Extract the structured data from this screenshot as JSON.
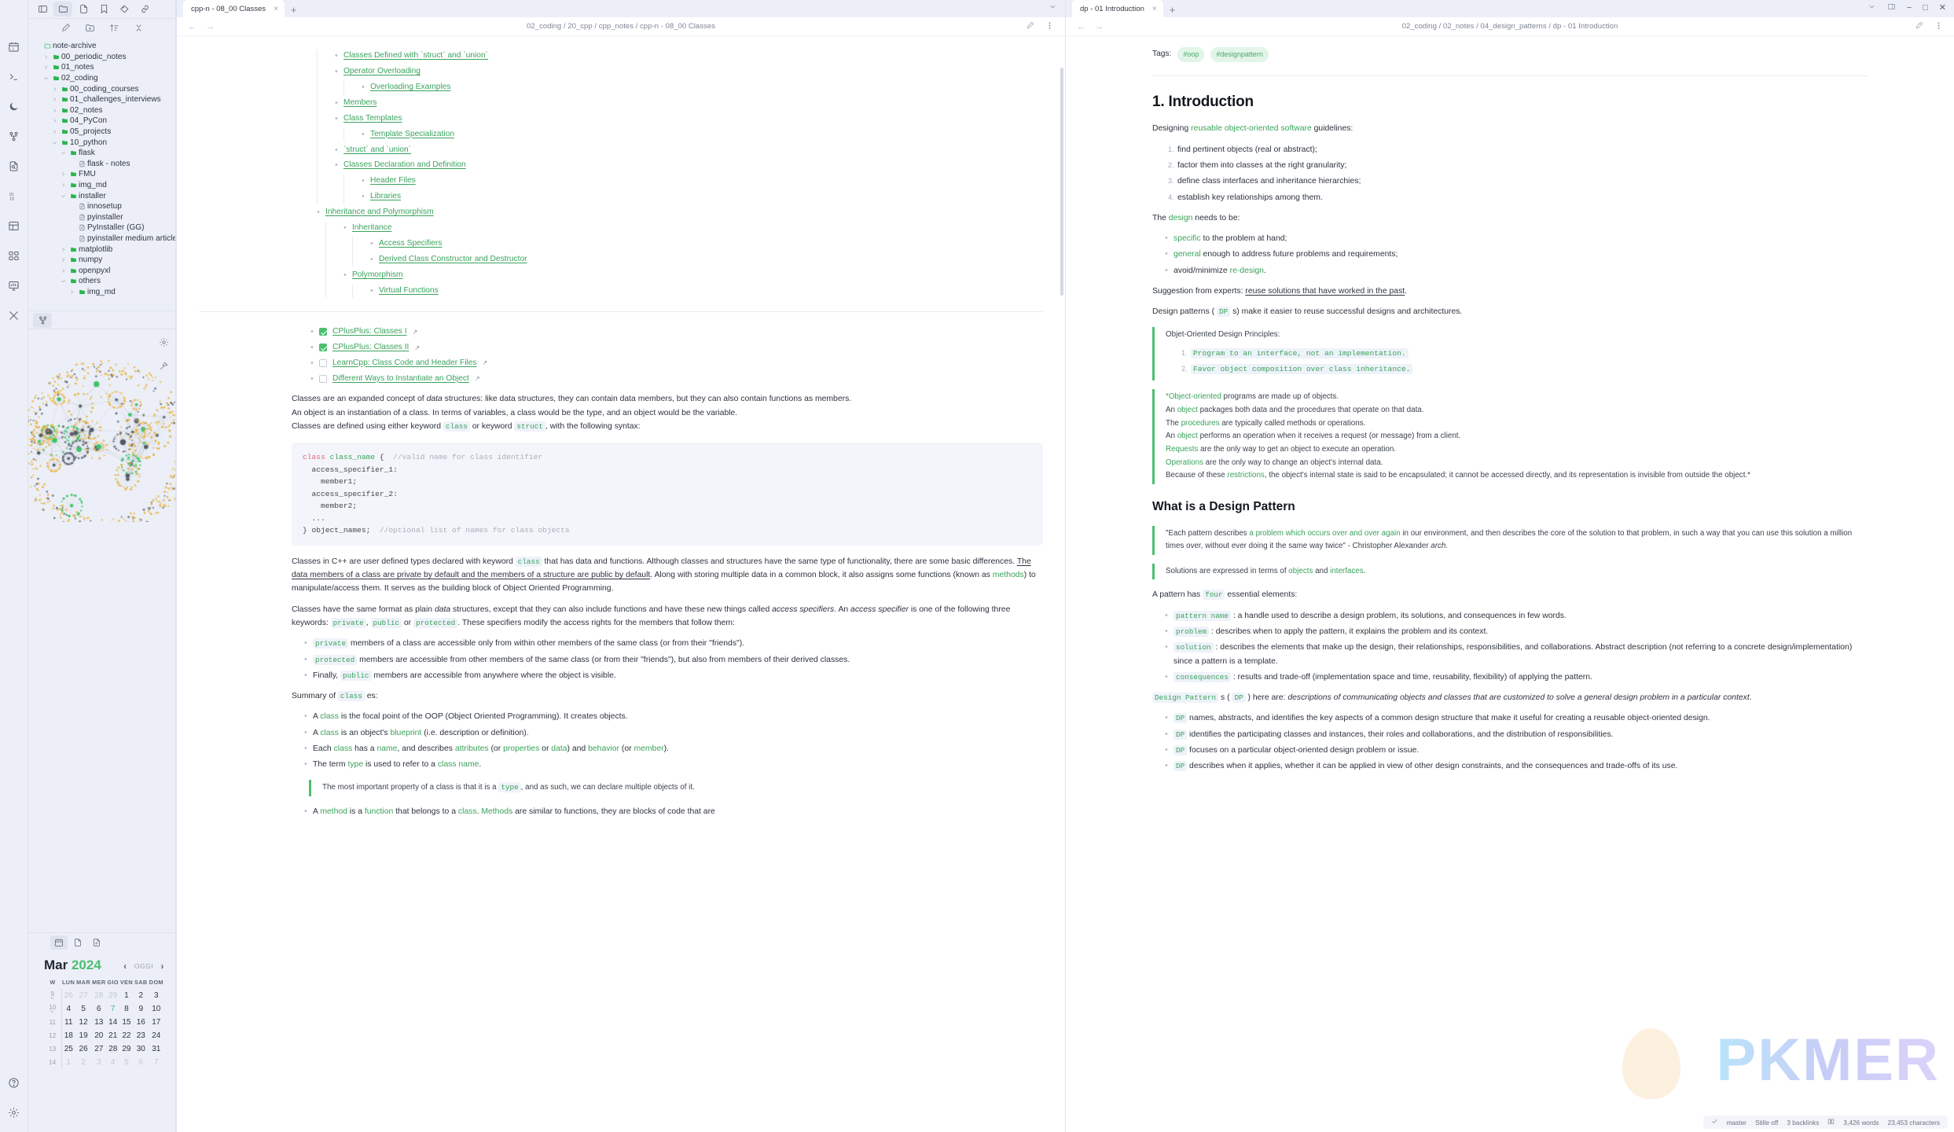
{
  "ribbon": {
    "top_icons": [
      "panel-left-icon",
      "folder-icon",
      "file-icon",
      "bookmark-icon",
      "tags-icon",
      "link-icon"
    ],
    "side_icons": [
      "calendar-icon",
      "terminal-icon",
      "moon-icon",
      "graph-icon",
      "file-search-icon",
      "binary-icon",
      "layout-icon",
      "grid-icon",
      "dashboard-icon",
      "tools-icon"
    ],
    "bottom_icons": [
      "help-icon",
      "settings-icon"
    ]
  },
  "sidebar": {
    "tabs": [
      "calendar-tab-icon",
      "terminal-tab-icon"
    ],
    "toolbar_icons": [
      "new-note-icon",
      "new-folder-icon",
      "sort-icon",
      "collapse-all-icon"
    ],
    "tree": [
      {
        "label": "note-archive",
        "depth": 0,
        "type": "vault",
        "arrow": "",
        "open": true
      },
      {
        "label": "00_periodic_notes",
        "depth": 1,
        "type": "folder",
        "arrow": "right"
      },
      {
        "label": "01_notes",
        "depth": 1,
        "type": "folder",
        "arrow": "right"
      },
      {
        "label": "02_coding",
        "depth": 1,
        "type": "folder",
        "arrow": "down"
      },
      {
        "label": "00_coding_courses",
        "depth": 2,
        "type": "folder",
        "arrow": "right"
      },
      {
        "label": "01_challenges_interviews",
        "depth": 2,
        "type": "folder",
        "arrow": "right"
      },
      {
        "label": "02_notes",
        "depth": 2,
        "type": "folder",
        "arrow": "right"
      },
      {
        "label": "04_PyCon",
        "depth": 2,
        "type": "folder",
        "arrow": "right"
      },
      {
        "label": "05_projects",
        "depth": 2,
        "type": "folder",
        "arrow": "right"
      },
      {
        "label": "10_python",
        "depth": 2,
        "type": "folder",
        "arrow": "down"
      },
      {
        "label": "flask",
        "depth": 3,
        "type": "folder",
        "arrow": "down"
      },
      {
        "label": "flask - notes",
        "depth": 4,
        "type": "file",
        "arrow": ""
      },
      {
        "label": "FMU",
        "depth": 3,
        "type": "folder",
        "arrow": "right"
      },
      {
        "label": "img_md",
        "depth": 3,
        "type": "folder",
        "arrow": "right"
      },
      {
        "label": "installer",
        "depth": 3,
        "type": "folder",
        "arrow": "down"
      },
      {
        "label": "innosetup",
        "depth": 4,
        "type": "file",
        "arrow": ""
      },
      {
        "label": "pyinstaller",
        "depth": 4,
        "type": "file",
        "arrow": ""
      },
      {
        "label": "PyInstaller (GG)",
        "depth": 4,
        "type": "file",
        "arrow": ""
      },
      {
        "label": "pyinstaller medium article",
        "depth": 4,
        "type": "file",
        "arrow": ""
      },
      {
        "label": "matplotlib",
        "depth": 3,
        "type": "folder",
        "arrow": "right"
      },
      {
        "label": "numpy",
        "depth": 3,
        "type": "folder",
        "arrow": "right"
      },
      {
        "label": "openpyxl",
        "depth": 3,
        "type": "folder",
        "arrow": "right"
      },
      {
        "label": "others",
        "depth": 3,
        "type": "folder",
        "arrow": "down"
      },
      {
        "label": "img_md",
        "depth": 4,
        "type": "folder",
        "arrow": "right"
      }
    ],
    "graph": {
      "settings_icon": "gear-icon",
      "restore_icon": "restore-view-icon"
    },
    "calendar": {
      "month": "Mar",
      "year": "2024",
      "today_label": "OGGI",
      "prev_icon": "chevron-left-icon",
      "next_icon": "chevron-right-icon",
      "weekday_headers": [
        "W",
        "LUN",
        "MAR",
        "MER",
        "GIO",
        "VEN",
        "SAB",
        "DOM"
      ],
      "weeks": [
        {
          "w": "9",
          "dots": true,
          "days": [
            {
              "d": "26",
              "dim": true
            },
            {
              "d": "27",
              "dim": true
            },
            {
              "d": "28",
              "dim": true
            },
            {
              "d": "29",
              "dim": true
            },
            {
              "d": "1"
            },
            {
              "d": "2"
            },
            {
              "d": "3"
            }
          ]
        },
        {
          "w": "10",
          "dots": true,
          "days": [
            {
              "d": "4"
            },
            {
              "d": "5"
            },
            {
              "d": "6"
            },
            {
              "d": "7",
              "today": true
            },
            {
              "d": "8"
            },
            {
              "d": "9"
            },
            {
              "d": "10"
            }
          ]
        },
        {
          "w": "11",
          "dots": false,
          "days": [
            {
              "d": "11"
            },
            {
              "d": "12"
            },
            {
              "d": "13"
            },
            {
              "d": "14"
            },
            {
              "d": "15"
            },
            {
              "d": "16"
            },
            {
              "d": "17"
            }
          ]
        },
        {
          "w": "12",
          "dots": false,
          "days": [
            {
              "d": "18"
            },
            {
              "d": "19"
            },
            {
              "d": "20"
            },
            {
              "d": "21"
            },
            {
              "d": "22"
            },
            {
              "d": "23"
            },
            {
              "d": "24"
            }
          ]
        },
        {
          "w": "13",
          "dots": false,
          "days": [
            {
              "d": "25"
            },
            {
              "d": "26"
            },
            {
              "d": "27"
            },
            {
              "d": "28"
            },
            {
              "d": "29"
            },
            {
              "d": "30"
            },
            {
              "d": "31"
            }
          ]
        },
        {
          "w": "14",
          "dots": false,
          "days": [
            {
              "d": "1",
              "dim": true
            },
            {
              "d": "2",
              "dim": true
            },
            {
              "d": "3",
              "dim": true
            },
            {
              "d": "4",
              "dim": true
            },
            {
              "d": "5",
              "dim": true
            },
            {
              "d": "6",
              "dim": true
            },
            {
              "d": "7",
              "dim": true
            }
          ]
        }
      ]
    }
  },
  "left_pane": {
    "tab_title": "cpp-n - 08_00 Classes",
    "close_label": "×",
    "new_tab_label": "+",
    "breadcrumb": "02_coding / 20_cpp / cpp_notes / cpp-n - 08_00 Classes",
    "toc": [
      {
        "label": "Classes Defined with `struct` and `union`",
        "depth": 1
      },
      {
        "label": "Operator Overloading",
        "depth": 1
      },
      {
        "label": "Overloading Examples",
        "depth": 2
      },
      {
        "label": "Members",
        "depth": 1
      },
      {
        "label": "Class Templates",
        "depth": 1
      },
      {
        "label": "Template Specialization",
        "depth": 2
      },
      {
        "label": "`struct` and `union`",
        "depth": 1
      },
      {
        "label": "Classes Declaration and Definition",
        "depth": 1
      },
      {
        "label": "Header Files",
        "depth": 2
      },
      {
        "label": "Libraries",
        "depth": 2
      },
      {
        "label": "Inheritance and Polymorphism",
        "depth": 0
      },
      {
        "label": "Inheritance",
        "depth": 1
      },
      {
        "label": "Access Specifiers",
        "depth": 2
      },
      {
        "label": "Derived Class Constructor and Destructor",
        "depth": 2
      },
      {
        "label": "Polymorphism",
        "depth": 1
      },
      {
        "label": "Virtual Functions",
        "depth": 2
      }
    ],
    "tasks": [
      {
        "label": "CPlusPlus: Classes I",
        "done": true
      },
      {
        "label": "CPlusPlus: Classes II",
        "done": true
      },
      {
        "label": "LearnCpp: Class Code and Header Files",
        "done": false
      },
      {
        "label": "Different Ways to Instantiate an Object",
        "done": false
      }
    ],
    "para1_a": "Classes are an expanded concept of ",
    "para1_em": "data",
    "para1_b": " structures: like data structures, they can contain data members, but they can also contain functions as members.",
    "para2": "An object is an instantiation of a class. In terms of variables, a class would be the type, and an object would be the variable.",
    "para3_a": "Classes are defined using either keyword ",
    "para3_code1": "class",
    "para3_b": " or keyword ",
    "para3_code2": "struct",
    "para3_c": ", with the following syntax:",
    "code_block": {
      "l1_kw": "class",
      "l1_cls": "class_name",
      "l1_rest": " {",
      "l1_cmt": "//valid name for class identifier",
      "l2": "  access_specifier_1:",
      "l3": "    member1;",
      "l4": "  access_specifier_2:",
      "l5": "    member2;",
      "l6": "  ...",
      "l7": "} object_names;",
      "l7_cmt": "//optional list of names for class objects"
    },
    "para4_a": "Classes in C++ are user defined types declared with keyword ",
    "para4_code": "class",
    "para4_b": " that has data and functions. Although classes and structures have the same type of functionality, there are some basic differences. ",
    "para4_u": "The data members of a class are private by default and the members of a structure are public by default",
    "para4_c": ". Along with storing multiple data in a common block, it also assigns some functions (known as ",
    "para4_grn": "methods",
    "para4_d": ") to manipulate/access them. It serves as the building block of Object Oriented Programming.",
    "para5_a": "Classes have the same format as plain ",
    "para5_em": "data",
    "para5_b": " structures, except that they can also include functions and have these new things called ",
    "para5_em2": "access specifiers",
    "para5_c": ". An ",
    "para5_em3": "access specifier",
    "para5_d": " is one of the following three keywords: ",
    "para5_code1": "private",
    "para5_e": ", ",
    "para5_code2": "public",
    "para5_f": " or ",
    "para5_code3": "protected",
    "para5_g": ". These specifiers modify the access rights for the members that follow them:",
    "spec_list": [
      {
        "code": "private",
        "text": " members of a class are accessible only from within other members of the same class (or from their \"friends\")."
      },
      {
        "code": "protected",
        "text": " members are accessible from other members of the same class (or from their \"friends\"), but also from members of their derived classes."
      },
      {
        "code": "public",
        "prefix": "Finally, ",
        "text": " members are accessible from anywhere where the object is visible."
      }
    ],
    "summary_a": "Summary of ",
    "summary_code": "class",
    "summary_b": " es:",
    "summary_list": [
      "A class is the focal point of the OOP (Object Oriented Programming). It creates objects.",
      "A class is an object's blueprint (i.e. description or definition).",
      "Each class has a name, and describes attributes (or properties or data) and behavior (or member).",
      "The term type is used to refer to a class name."
    ],
    "quote_a": "The most important property of a class is that it is a ",
    "quote_code": "type",
    "quote_b": ", and as such, we can declare multiple objects of it.",
    "last_line": "A method is a function that belongs to a class. Methods are similar to functions, they are blocks of code that are"
  },
  "right_pane": {
    "tab_title": "dp - 01 Introduction",
    "breadcrumb": "02_coding / 02_notes / 04_design_patterns / dp - 01 Introduction",
    "window_controls": [
      "chevron-down-icon",
      "sidebar-right-icon",
      "minimize-icon",
      "maximize-icon",
      "close-icon"
    ],
    "tags_label": "Tags:",
    "tags": [
      "#oop",
      "#designpattern"
    ],
    "h1": "1. Introduction",
    "intro_a": "Designing ",
    "intro_grn": "reusable object-oriented software",
    "intro_b": " guidelines:",
    "guidelines": [
      "find pertinent objects (real or abstract);",
      "factor them into classes at the right granularity;",
      "define class interfaces and inheritance hierarchies;",
      "establish key relationships among them."
    ],
    "design_a": "The ",
    "design_grn": "design",
    "design_b": " needs to be:",
    "design_list": [
      {
        "grn": "specific",
        "text": " to the problem at hand;"
      },
      {
        "grn": "general",
        "text": " enough to address future problems and requirements;"
      },
      {
        "prefix": "avoid/minimize ",
        "grn": "re-design",
        "text": "."
      }
    ],
    "suggestion_a": "Suggestion from experts: ",
    "suggestion_u": "reuse solutions that have worked in the past",
    "suggestion_b": ".",
    "dp_line_a": "Design patterns ( ",
    "dp_line_code": "DP",
    "dp_line_b": " s) make it easier to reuse successful designs and architectures.",
    "principles_title": "Objet-Oriented Design Principles:",
    "principles": [
      "Program to an interface, not an implementation.",
      "Favor object composition over class inheritance."
    ],
    "oo_quote": [
      {
        "grn": "*Object-oriented",
        "text": " programs are made up of objects."
      },
      {
        "prefix": "An ",
        "grn": "object",
        "text": " packages both data and the procedures that operate on that data."
      },
      {
        "prefix": "The ",
        "grn": "procedures",
        "text": " are typically called methods or operations."
      },
      {
        "prefix": "An ",
        "grn": "object",
        "text": " performs an operation when it receives a request (or message) from a client."
      },
      {
        "grn": "Requests",
        "text": " are the only way to get an object to execute an operation."
      },
      {
        "grn": "Operations",
        "text": " are the only way to change an object's internal data."
      },
      {
        "prefix": "Because of these ",
        "grn": "restrictions",
        "text": ", the object's internal state is said to be encapsulated; it cannot be accessed directly, and its representation is invisible from outside the object.*"
      }
    ],
    "h2": "What is a Design Pattern",
    "pattern_quote_a": "\"Each pattern describes ",
    "pattern_quote_grn": "a problem which occurs over and over again",
    "pattern_quote_b": " in our environment, and then describes the core of the solution to that problem, in such a way that you can use this solution a million times over, without ever doing it the same way twice\" - Christopher Alexander ",
    "pattern_quote_em": "arch.",
    "solutions_a": "Solutions are expressed in terms of ",
    "solutions_grn1": "objects",
    "solutions_mid": " and ",
    "solutions_grn2": "interfaces",
    "solutions_b": ".",
    "fourel_a": "A pattern has ",
    "fourel_code": "four",
    "fourel_b": " essential elements:",
    "elements": [
      {
        "code": "pattern name",
        "text": " : a handle used to describe a design problem, its solutions, and consequences in few words."
      },
      {
        "code": "problem",
        "text": " : describes when to apply the pattern, it explains the problem and its context."
      },
      {
        "code": "solution",
        "text": " : describes the elements that make up the design, their relationships, responsibilities, and collaborations. Abstract description (not referring to a concrete design/implementation) since a pattern is a template."
      },
      {
        "code": "consequences",
        "text": " : results and trade-off (implementation space and time, reusability, flexibility) of applying the pattern."
      }
    ],
    "dpdef_code1": "Design Pattern",
    "dpdef_a": " s ( ",
    "dpdef_code2": "DP",
    "dpdef_b": " ) here are: ",
    "dpdef_em": "descriptions of communicating objects and classes that are customized to solve a general design problem in a particular context",
    "dpdef_c": ".",
    "dp_list": [
      {
        "code": "DP",
        "text": " names, abstracts, and identifies the key aspects of a common design structure that make it useful for creating a reusable object-oriented design."
      },
      {
        "code": "DP",
        "text": " identifies the participating classes and instances, their roles and collaborations, and the distribution of responsibilities."
      },
      {
        "code": "DP",
        "text": " focuses on a particular object-oriented design problem or issue."
      },
      {
        "code": "DP",
        "text": " describes when it applies, whether it can be applied in view of other design constraints, and the consequences and trade-offs of its use."
      }
    ],
    "watermark_text": "PKMER",
    "status": {
      "check_icon": "check-icon",
      "branch": "master",
      "silence": "Stille off",
      "backlinks": "3 backlinks",
      "book_icon": "book-icon",
      "words": "3,426 words",
      "characters": "23,453 characters"
    }
  }
}
